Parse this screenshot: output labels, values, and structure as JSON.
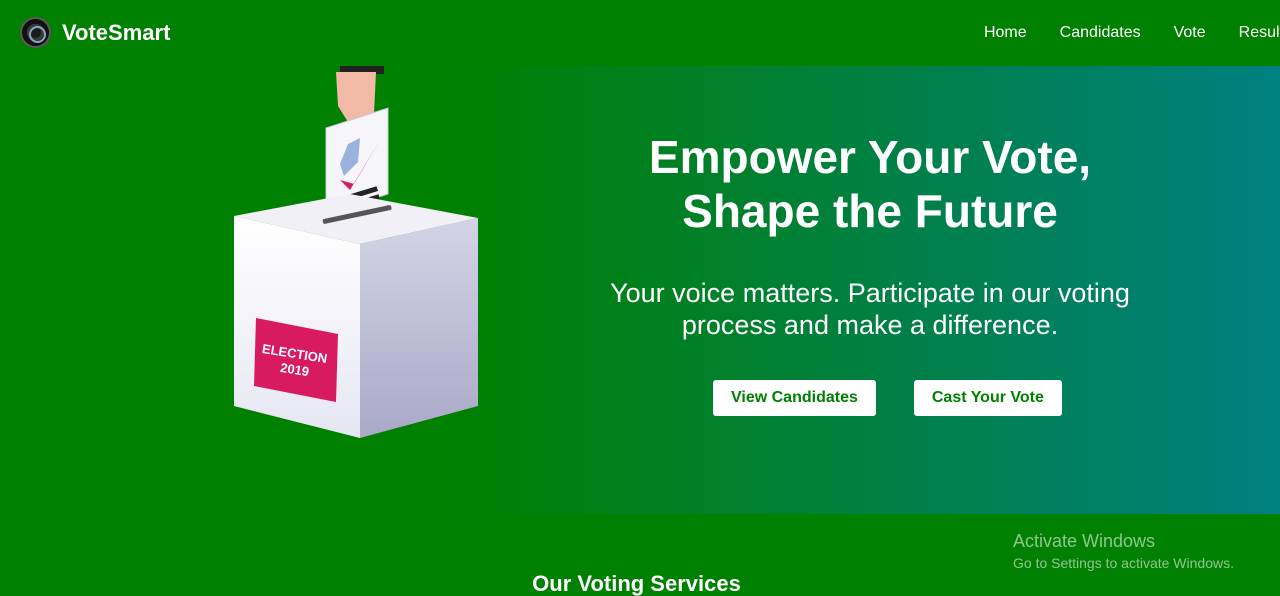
{
  "brand": {
    "name": "VoteSmart",
    "logo_icon": "camera-lens-icon"
  },
  "nav": {
    "items": [
      "Home",
      "Candidates",
      "Vote",
      "Results"
    ]
  },
  "hero": {
    "title_line1": "Empower Your Vote,",
    "title_line2": "Shape the Future",
    "subtitle_line1": "Your voice matters. Participate in our voting",
    "subtitle_line2": "process and make a difference.",
    "buttons": {
      "view_candidates": "View Candidates",
      "cast_vote": "Cast Your Vote"
    },
    "ballot_label_line1": "ELECTION",
    "ballot_label_line2": "2019"
  },
  "services": {
    "title": "Our Voting Services"
  },
  "watermark": {
    "title": "Activate Windows",
    "subtitle": "Go to Settings to activate Windows."
  },
  "colors": {
    "primary_green": "#008000",
    "teal": "#008080",
    "ballot_label": "#d81b60",
    "button_bg": "#ffffff"
  }
}
